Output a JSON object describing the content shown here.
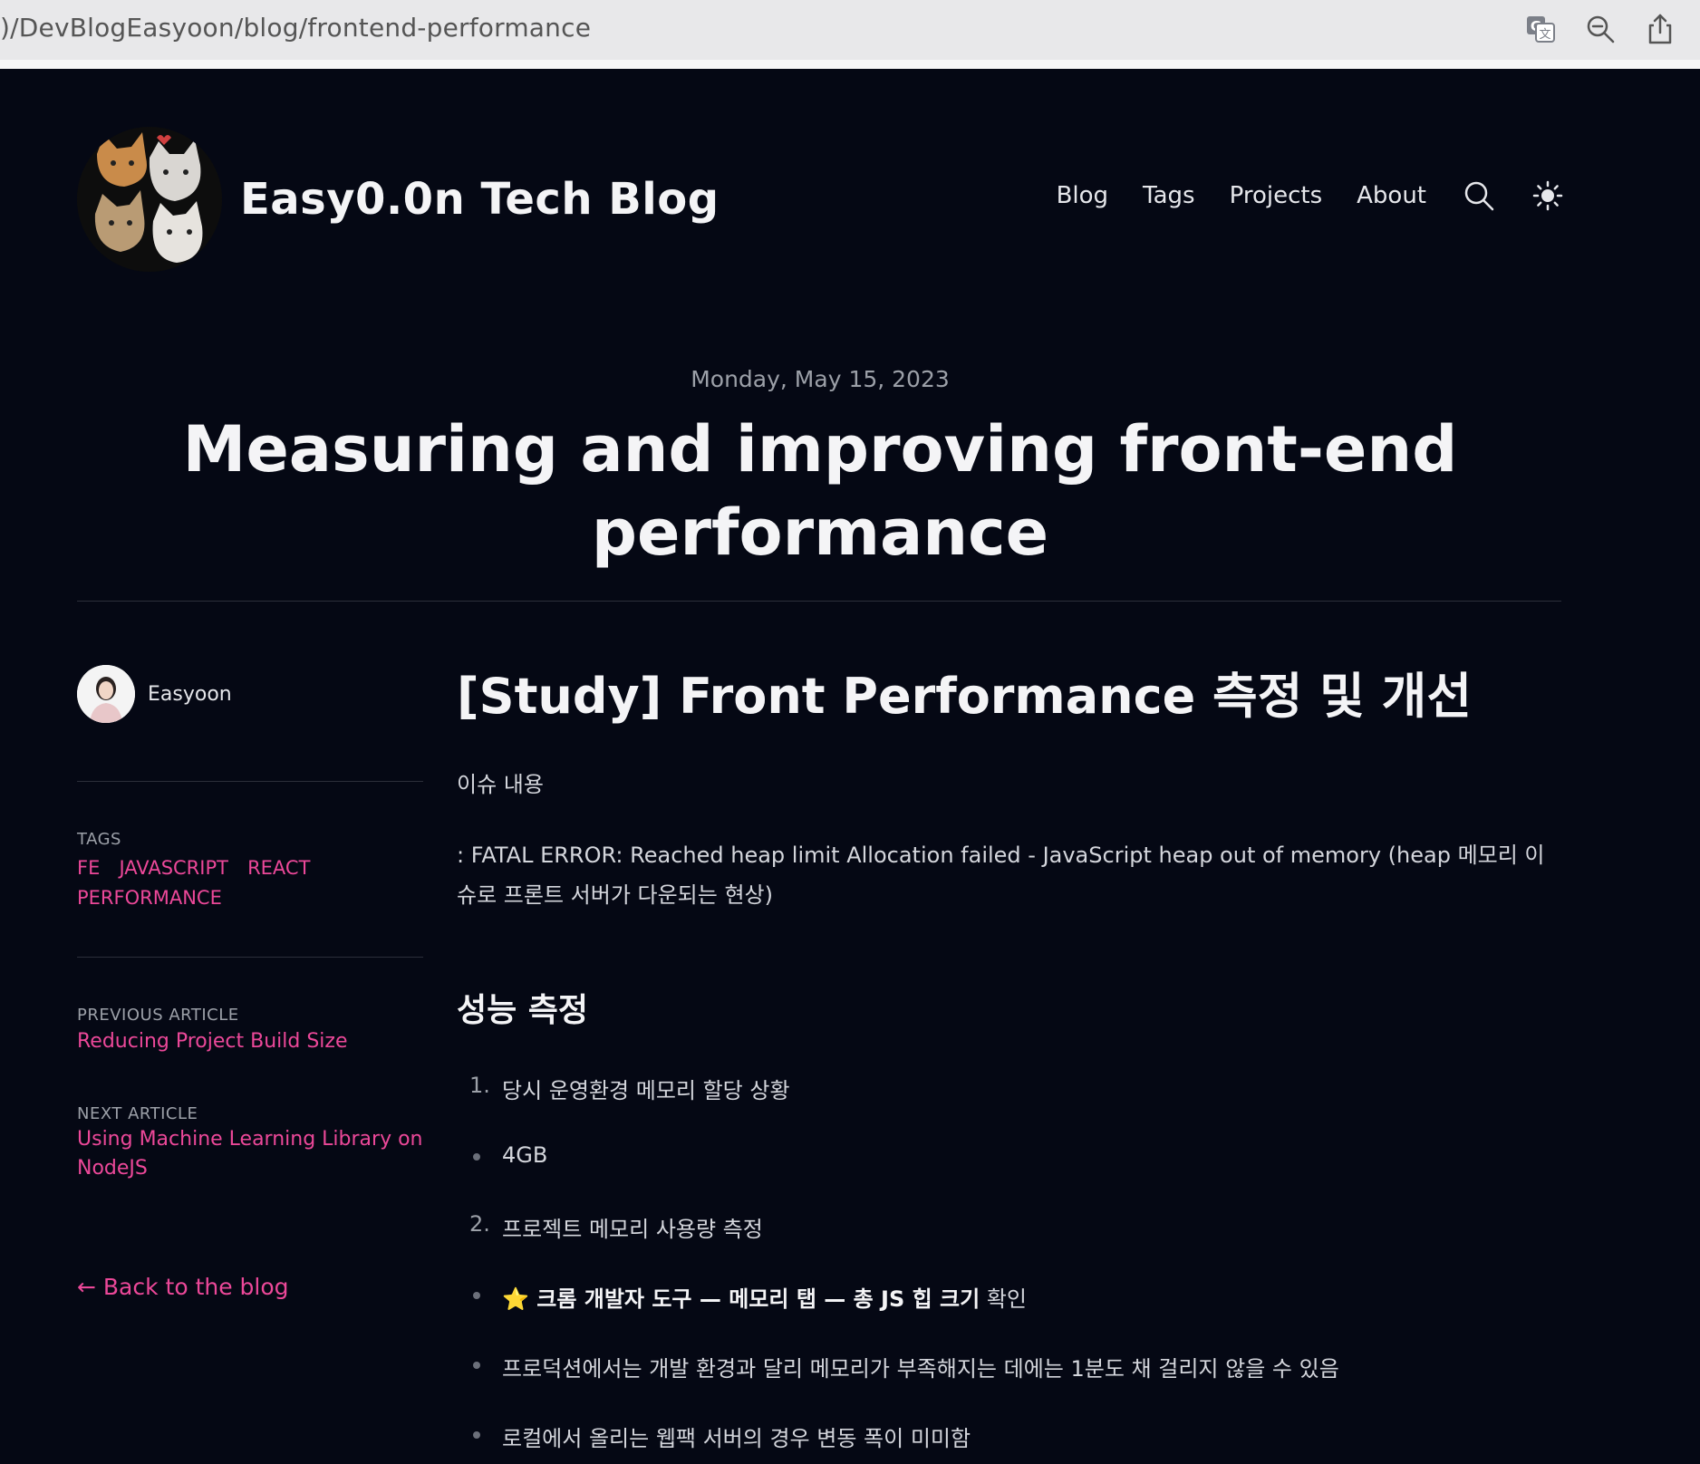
{
  "browser": {
    "url": ")/DevBlogEasyoon/blog/frontend-performance",
    "icons": [
      "translate-icon",
      "zoom-out-icon",
      "share-icon"
    ]
  },
  "header": {
    "site_title": "Easy0.0n Tech Blog",
    "nav": [
      "Blog",
      "Tags",
      "Projects",
      "About"
    ],
    "icons": [
      "search-icon",
      "theme-toggle-sun-icon"
    ]
  },
  "article": {
    "date": "Monday, May 15, 2023",
    "title": "Measuring and improving front-end performance"
  },
  "sidebar": {
    "author": "Easyoon",
    "tags_label": "TAGS",
    "tags": [
      "FE",
      "JAVASCRIPT",
      "REACT",
      "PERFORMANCE"
    ],
    "previous_label": "PREVIOUS ARTICLE",
    "previous_title": "Reducing Project Build Size",
    "next_label": "NEXT ARTICLE",
    "next_title": "Using Machine Learning Library on NodeJS",
    "back_link": "← Back to the blog"
  },
  "content": {
    "heading": "[Study] Front Performance 측정 및 개선",
    "issue_label": "이슈 내용",
    "issue_text": ": FATAL ERROR: Reached heap limit Allocation failed - JavaScript heap out of memory (heap 메모리 이슈로 프론트 서버가 다운되는 현상)",
    "section_heading": "성능 측정",
    "items": {
      "i1_marker": "1.",
      "i1_text": "당시 운영환경 메모리 할당 상황",
      "i2_text": "4GB",
      "i3_marker": "2.",
      "i3_text": "프로젝트 메모리 사용량 측정",
      "i4_bold": "⭐ 크롬 개발자 도구 — 메모리 탭 — 총 JS 힙 크기",
      "i4_rest": " 확인",
      "i5_text": "프로덕션에서는 개발 환경과 달리 메모리가 부족해지는 데에는 1분도 채 걸리지 않을 수 있음",
      "i6_text": "로컬에서 올리는 웹팩 서버의 경우 변동 폭이 미미함"
    }
  },
  "colors": {
    "background": "#050814",
    "accent": "#ec4899",
    "text": "#e6e7eb",
    "muted": "#9ca0a8"
  }
}
